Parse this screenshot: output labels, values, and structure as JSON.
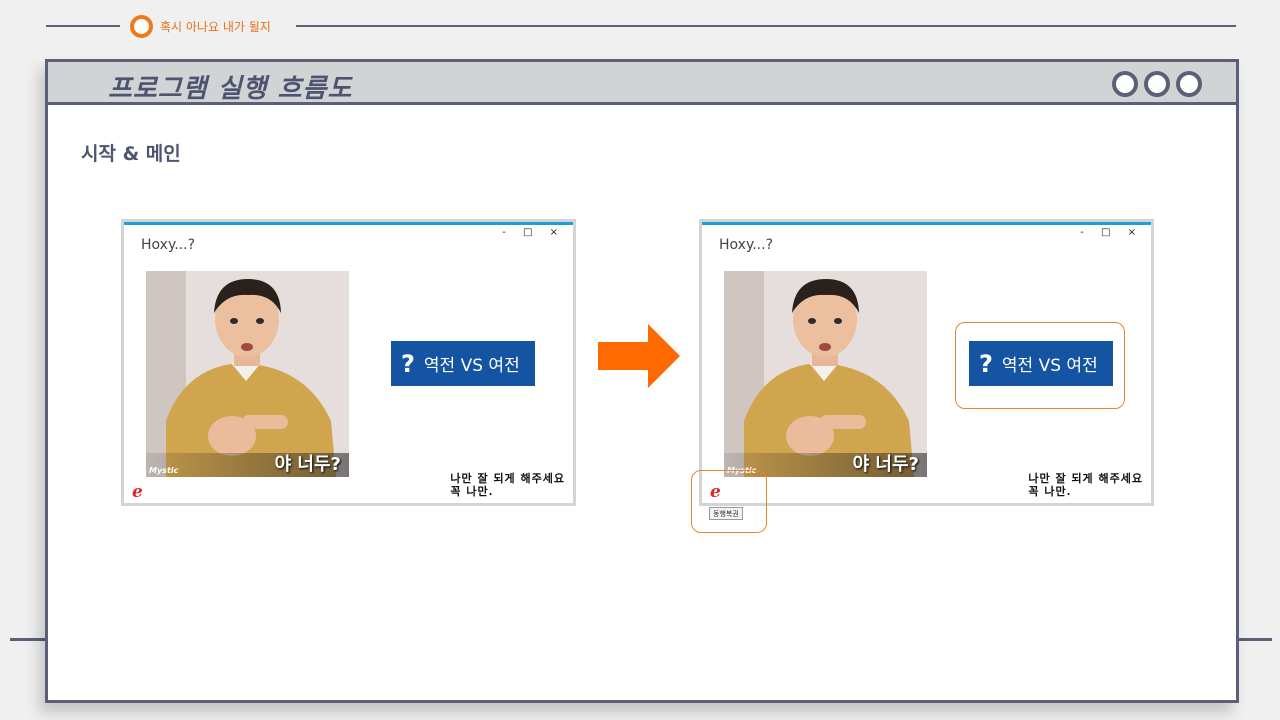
{
  "header": {
    "caption": "혹시 아나요 내가 될지"
  },
  "window": {
    "title": "프로그램 실행 흐름도",
    "section_title": "시작 & 메인"
  },
  "screens": [
    {
      "app_title": "Hoxy...?",
      "controls": "- □ ×",
      "photo_caption": "야 너두?",
      "photo_brand": "Mystic",
      "button_label": "역전 VS 여전",
      "plea_line1": "나만 잘 되게 해주세요",
      "plea_line2": "꼭 나만."
    },
    {
      "app_title": "Hoxy...?",
      "controls": "- □ ×",
      "photo_caption": "야 너두?",
      "photo_brand": "Mystic",
      "button_label": "역전 VS 여전",
      "plea_line1": "나만 잘 되게 해주세요",
      "plea_line2": "꼭 나만.",
      "tooltip": "동행복권"
    }
  ],
  "colors": {
    "accent": "#f07a1a",
    "frame": "#5b6078",
    "button": "#1554a3",
    "highlight": "#e7842e"
  }
}
